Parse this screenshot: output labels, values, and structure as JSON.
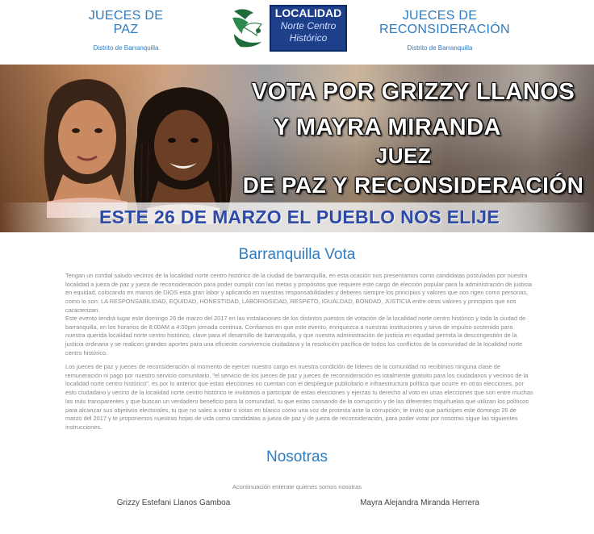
{
  "header": {
    "left_title_line1": "JUECES DE",
    "left_title_line2": "PAZ",
    "left_sub": "Distrito de Barranquilla",
    "right_title_line1": "JUECES DE",
    "right_title_line2": "RECONSIDERACIÓN",
    "right_sub": "Distrito de Barranquilla",
    "logo": {
      "line1": "LOCALIDAD",
      "line2": "Norte Centro",
      "line3": "Histórico"
    }
  },
  "banner": {
    "line1": "VOTA POR GRIZZY LLANOS",
    "line2": "Y MAYRA MIRANDA",
    "line3": "JUEZ",
    "line4": "DE PAZ Y RECONSIDERACIÓN",
    "strip": "ESTE 26 DE MARZO EL PUEBLO NOS ELIJE"
  },
  "section1": {
    "title": "Barranquilla Vota",
    "paragraph1": "Tengan un cordial saludo vecinos de la localidad norte centro histórico de la ciudad de barranquilla, en esta ocasión nos presentamos como candidatas postuladas por nuestra localidad a jueza de paz y jueza de reconsideración para poder cumplir con las metas y propósitos que requiere este cargo de elección popular para la administración de justicia en equidad, colocando en manos de DIOS esta gran labor y aplicando en nuestras responsabilidades y deberes siempre los principios y valores que nos rigen como personas, como lo son: LA RESPONSABILIDAD, EQUIDAD, HONESTIDAD, LABORIOSIDAD, RESPETO, IGUALDAD, BONDAD, JUSTICIA entre otros valores y principios que nos caracterizan.",
    "paragraph2": "Este evento tendrá lugar este domingo 26 de marzo del 2017 en las instalaciones de los distintos puestos de votación de la localidad norte centro histórico y toda la ciudad de barranquilla, en los horarios de 8:00AM a 4:00pm jornada continua. Confiamos en que este evento, enriquezca a nuestras instituciones y sirva de impulso sostenido para nuestra querida localidad norte centro histórico, clave para el desarrollo de barranquilla, y que nuestra administración de justicia en equidad permita la descongestión de la justicia ordinaria y se realicen grandes aportes para una eficiente convivencia ciudadana y la resolución pacífica de todos los conflictos de la comunidad de la localidad norte centro histórico.",
    "paragraph3": "Los jueces de paz y jueces de reconsideración al momento de ejercer nuestro cargo en nuestra condición de líderes de la comunidad no recibimos ninguna clase de remuneración ni pago por nuestro servicio comunitario, \"el servicio de los jueces de paz y jueces de reconsideración es totalmente gratuito para los ciudadanos y vecinos de la localidad norte centro histórico\", es por lo anterior que estas elecciones no cuentan con el despliegue publicitario e infraestructura política que ocurre en otras elecciones, por esto ciudadano y vecino de la localidad norte centro histórico te invitamos a participar de estas elecciones y ejerzas tu derecho al voto en unas elecciones que son entre muchas las más transparentes y que buscan un verdadero beneficio para la comunidad, tu que estas cansando de la corrupción y de las diferentes triquiñuelas que utilizan los políticos para alcanzar sus objetivos electorales, tu que no sales a votar o votas en blanco como una voz de protesta ante la corrupción; te invito que participes este domingo 26 de marzo del 2017 y te proponemos nuestras hojas de vida como candidatas a jueza de paz y de jueza de reconsideración, para poder votar por nosotras sigue las siguientes instrucciones."
  },
  "section2": {
    "title": "Nosotras",
    "intro": "Acontinuación enterate quienes somos nosotras",
    "name1": "Grizzy Estefani Llanos Gamboa",
    "name2": "Mayra Alejandra Miranda Herrera"
  },
  "colors": {
    "accent_blue": "#2e7bbf",
    "strip_text": "#2d4aa6",
    "logo_bg": "#1e3f8a"
  }
}
